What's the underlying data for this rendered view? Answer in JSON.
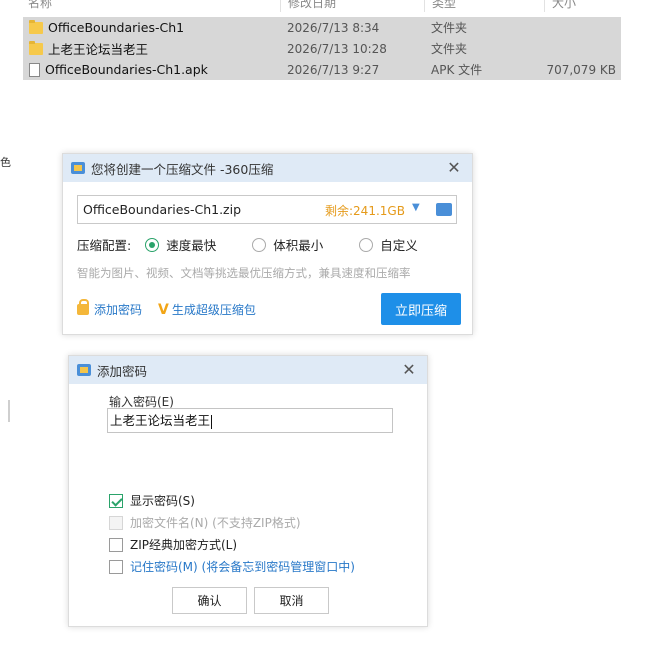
{
  "explorer": {
    "columns": [
      "名称",
      "修改日期",
      "类型",
      "大小"
    ],
    "files": [
      {
        "icon": "folder-icon",
        "name": "OfficeBoundaries-Ch1",
        "date": "2026/7/13 8:34",
        "type": "文件夹",
        "size": ""
      },
      {
        "icon": "folder-icon",
        "name": "上老王论坛当老王",
        "date": "2026/7/13 10:28",
        "type": "文件夹",
        "size": ""
      },
      {
        "icon": "file-icon",
        "name": "OfficeBoundaries-Ch1.apk",
        "date": "2026/7/13 9:27",
        "type": "APK 文件",
        "size": "707,079 KB"
      }
    ],
    "left_char": "色"
  },
  "compress_dialog": {
    "title": "您将创建一个压缩文件 -360压缩",
    "filename": "OfficeBoundaries-Ch1.zip",
    "remaining": "剩余:241.1GB",
    "config_label": "压缩配置:",
    "options": [
      {
        "label": "速度最快",
        "checked": true
      },
      {
        "label": "体积最小",
        "checked": false
      },
      {
        "label": "自定义",
        "checked": false
      }
    ],
    "hint": "智能为图片、视频、文档等挑选最优压缩方式，兼具速度和压缩率",
    "add_password": "添加密码",
    "super_package": "生成超级压缩包",
    "compress_button": "立即压缩"
  },
  "password_dialog": {
    "title": "添加密码",
    "input_label": "输入密码(E)",
    "input_value": "上老王论坛当老王",
    "checkboxes": [
      {
        "label": "显示密码(S)",
        "checked": true,
        "disabled": false,
        "style": "normal"
      },
      {
        "label": "加密文件名(N) (不支持ZIP格式)",
        "checked": false,
        "disabled": true,
        "style": "disabled"
      },
      {
        "label": "ZIP经典加密方式(L)",
        "checked": false,
        "disabled": false,
        "style": "normal"
      },
      {
        "label": "记住密码(M) (将会备忘到密码管理窗口中)",
        "checked": false,
        "disabled": false,
        "style": "link"
      }
    ],
    "ok_button": "确认",
    "cancel_button": "取消"
  },
  "colors": {
    "accent": "#1e8fe8",
    "title_bar": "#dfeaf6",
    "check_green": "#2aa36a",
    "remain_orange": "#e59a1a",
    "selection_gray": "#d7d7d7"
  }
}
